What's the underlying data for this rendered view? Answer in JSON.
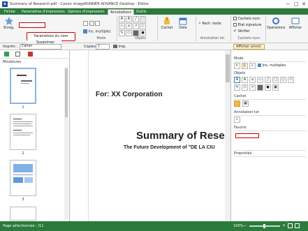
{
  "window": {
    "title": "Summary of Research.pdf - Canon imageRUNNER ADVANCE Desktop - Editor",
    "controls": [
      "─",
      "□",
      "✕"
    ]
  },
  "menu": {
    "tabs": [
      "Fichier",
      "Paramètres d'impression",
      "Options d'impression",
      "Annotations",
      "Outils"
    ],
    "active": 3
  },
  "ribbon": {
    "enreg": "Enreg.",
    "ins_multiples": "Ins. multiples",
    "mode_label": "Mode",
    "objets_label": "Objets",
    "cachet": "Cachet",
    "date": "Date",
    "rech_texte": "Rech. texte",
    "annotation_txt_label": "Annotation txt",
    "cachets_num": "Cachets num.",
    "etat_signature": "Etat signature",
    "verifier": "Vérifier",
    "cachets_num_group": "Cachets num.",
    "operations": "Opérations",
    "afficher": "Afficher",
    "afficher_annot": "Afficher annot.",
    "popup_item1": "Paramètres du nom",
    "popup_item2": "Supprimer"
  },
  "toolbar2": {
    "imprim_label": "Imprim :",
    "imprim_value": "Canon",
    "copies_label": "Copies :",
    "copies_value": "1",
    "imp_label": "Imp."
  },
  "left_pane": {
    "label": "Miniatures",
    "pages": [
      "1",
      "2",
      "3"
    ]
  },
  "document": {
    "for_line": "For: XX Corporation",
    "title": "Summary of Resea",
    "subtitle": "The Future Development of \"DE LA CIU"
  },
  "right_pane": {
    "mode_label": "Mode",
    "ins_multiples": "Ins. multiples",
    "objets_label": "Objets",
    "cachet_label": "Cachet",
    "annotation_txt_label": "Annotation txt",
    "favoris_label": "Favoris",
    "proprietes_label": "Propriétés"
  },
  "status": {
    "page": "Page sélectionnée : /11",
    "zoom": "100%"
  },
  "colors": {
    "accent": "#2a7b3c",
    "popup_border": "#cc0000"
  }
}
